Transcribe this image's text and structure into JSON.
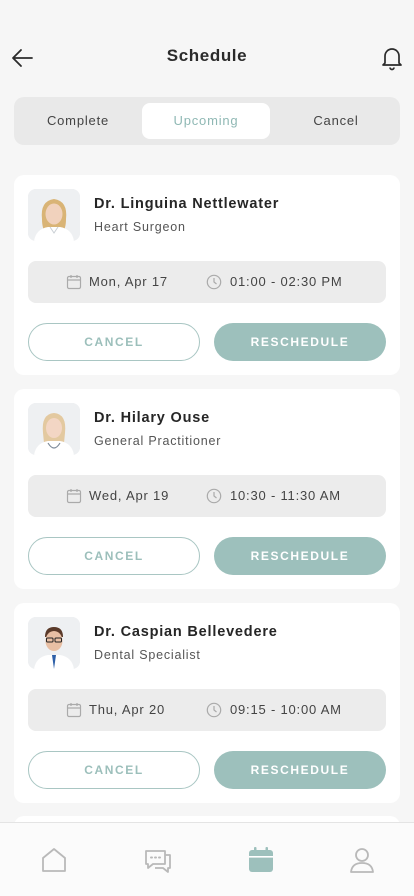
{
  "header": {
    "title": "Schedule",
    "back_icon": "arrow-left-icon",
    "bell_icon": "bell-icon"
  },
  "tabs": [
    {
      "label": "Complete",
      "active": false
    },
    {
      "label": "Upcoming",
      "active": true
    },
    {
      "label": "Cancel",
      "active": false
    }
  ],
  "appointments": [
    {
      "name": "Dr. Linguina Nettlewater",
      "specialty": "Heart Surgeon",
      "date": "Mon, Apr 17",
      "time": "01:00 - 02:30 PM",
      "cancel_label": "CANCEL",
      "reschedule_label": "RESCHEDULE"
    },
    {
      "name": "Dr. Hilary Ouse",
      "specialty": "General Practitioner",
      "date": "Wed, Apr 19",
      "time": "10:30 - 11:30 AM",
      "cancel_label": "CANCEL",
      "reschedule_label": "RESCHEDULE"
    },
    {
      "name": "Dr. Caspian Bellevedere",
      "specialty": "Dental Specialist",
      "date": "Thu, Apr 20",
      "time": "09:15 - 10:00 AM",
      "cancel_label": "CANCEL",
      "reschedule_label": "RESCHEDULE"
    }
  ],
  "bottom_nav": [
    {
      "icon": "home-icon",
      "active": false
    },
    {
      "icon": "chat-icon",
      "active": false
    },
    {
      "icon": "calendar-icon",
      "active": true
    },
    {
      "icon": "profile-icon",
      "active": false
    }
  ],
  "colors": {
    "accent": "#9dc0bc",
    "accent_text": "#8fb8b4",
    "background": "#f6f6f6",
    "card": "#ffffff"
  }
}
